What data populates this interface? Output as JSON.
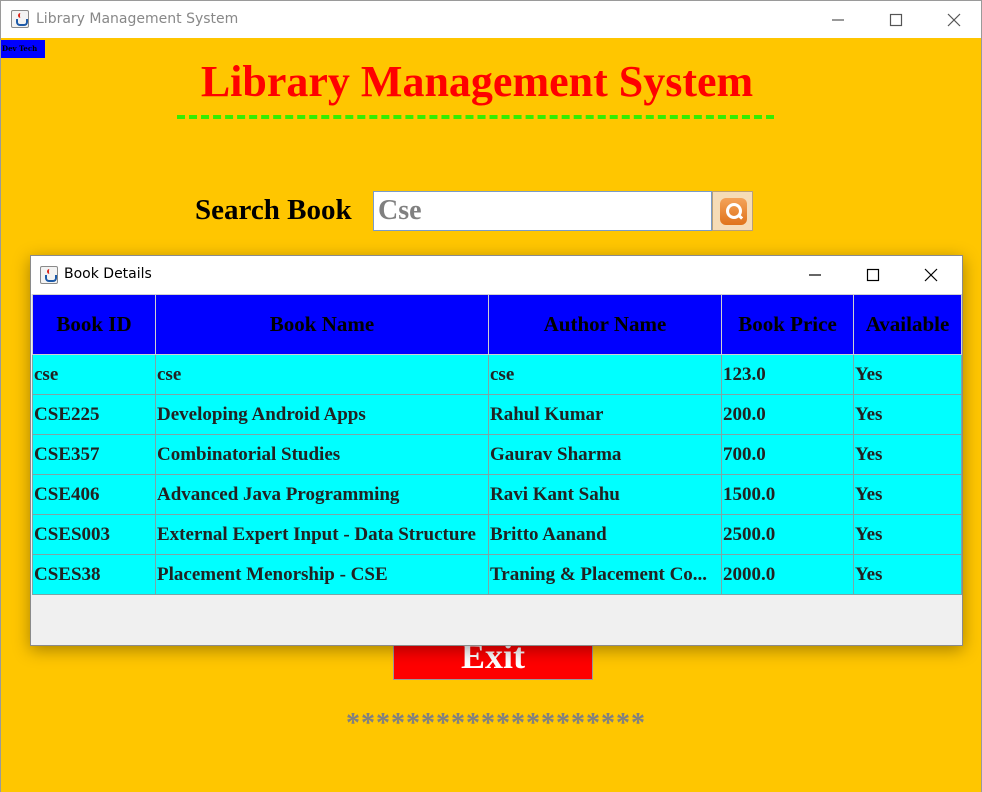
{
  "window": {
    "title": "Library Management System"
  },
  "main": {
    "dev_tag": "Dev Tech",
    "app_title": "Library Management System",
    "search_label": "Search Book",
    "search_value": "Cse",
    "exit_label": "Exit",
    "stars": "********************"
  },
  "dialog": {
    "title": "Book Details",
    "columns": [
      "Book ID",
      "Book Name",
      "Author Name",
      "Book Price",
      "Available"
    ],
    "rows": [
      [
        "cse",
        "cse",
        "cse",
        "123.0",
        "Yes"
      ],
      [
        "CSE225",
        "Developing Android Apps",
        "Rahul Kumar",
        "200.0",
        "Yes"
      ],
      [
        "CSE357",
        "Combinatorial Studies",
        "Gaurav Sharma",
        "700.0",
        "Yes"
      ],
      [
        "CSE406",
        "Advanced Java Programming",
        "Ravi Kant Sahu",
        "1500.0",
        "Yes"
      ],
      [
        "CSES003",
        "External Expert Input - Data Structure",
        "Britto Aanand",
        "2500.0",
        "Yes"
      ],
      [
        "CSES38",
        "Placement Menorship - CSE",
        "Traning & Placement Co...",
        "2000.0",
        "Yes"
      ]
    ]
  },
  "colors": {
    "background": "#ffc600",
    "title_red": "#ff0000",
    "underline_green": "#33ee00",
    "header_blue": "#0000ff",
    "cell_cyan": "#00ffff"
  },
  "icons": {
    "window_icon": "java-cup-icon",
    "search_icon": "magnifier-icon"
  }
}
